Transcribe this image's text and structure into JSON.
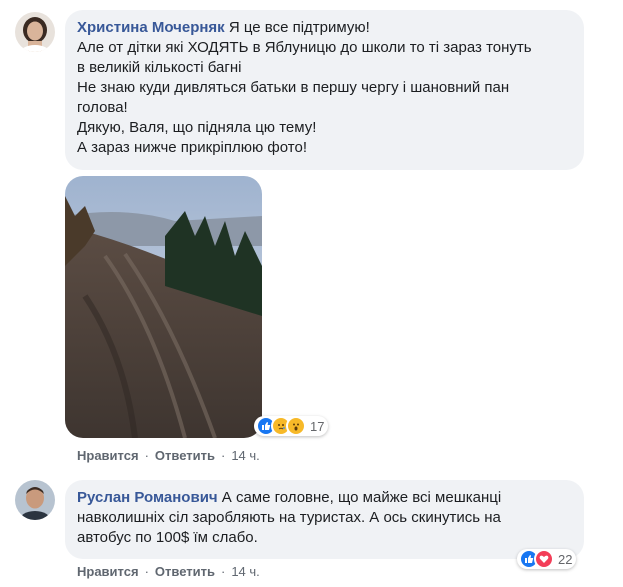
{
  "comments": [
    {
      "author": "Христина Мочерняк",
      "first_line": "Я це все підтримую!",
      "lines": [
        "Але от дітки які ХОДЯТЬ в Яблуницю до школи то ті зараз тонуть",
        "в великій кількості багні",
        "Не знаю куди дивляться батьки в першу чергу і шановний пан",
        "голова!",
        "Дякую, Валя, що підняла цю тему!",
        "А зараз нижче прикріплюю фото!"
      ],
      "reaction_icons": [
        "like-icon",
        "sad-icon",
        "wow-icon"
      ],
      "reaction_count": "17",
      "like_label": "Нравится",
      "reply_label": "Ответить",
      "time": "14 ч."
    },
    {
      "author": "Руслан Романович",
      "first_line": "А саме головне, що майже всі мешканці",
      "lines": [
        "навколишніх сіл заробляють на туристах. А ось скинутись на",
        "автобус по 100$ їм слабо."
      ],
      "reaction_icons": [
        "like-icon",
        "love-icon"
      ],
      "reaction_count": "22",
      "like_label": "Нравится",
      "reply_label": "Ответить",
      "time": "14 ч."
    }
  ],
  "separator": "·",
  "colors": {
    "author": "#385898",
    "bubble": "#f0f2f5",
    "meta": "#606770",
    "like": "#1877f2",
    "love": "#f33e58",
    "haha": "#f7b928"
  }
}
